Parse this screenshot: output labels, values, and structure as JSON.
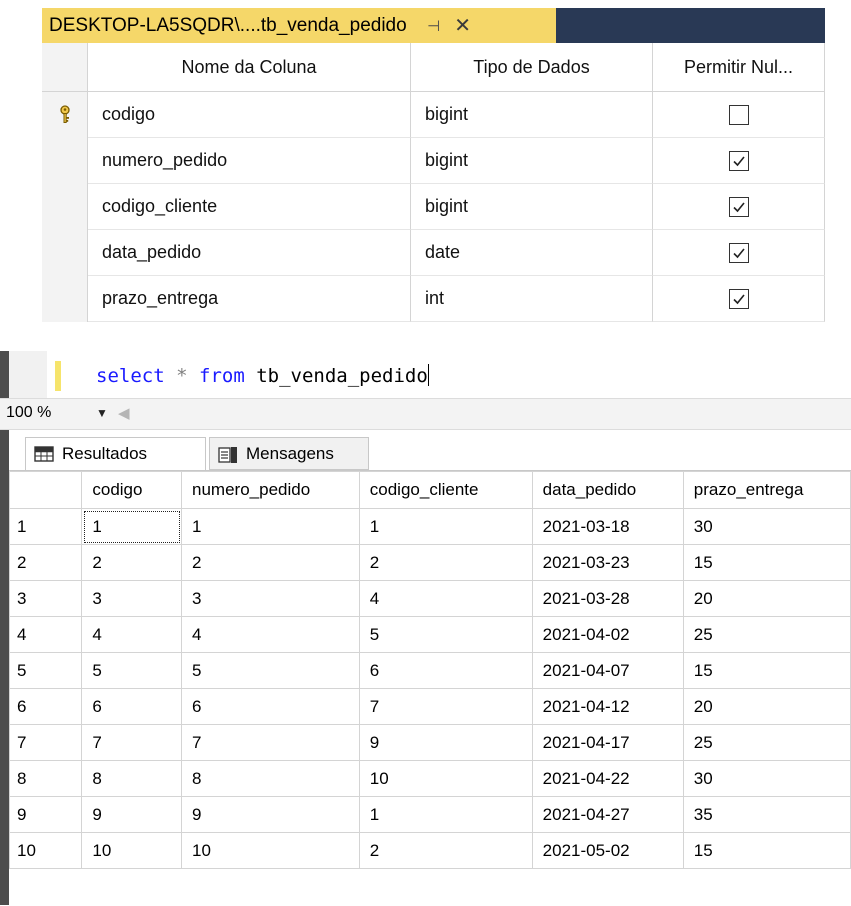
{
  "designer": {
    "tab_title": "DESKTOP-LA5SQDR\\....tb_venda_pedido",
    "columns_header": {
      "name": "Nome da Coluna",
      "type": "Tipo de Dados",
      "nullable": "Permitir Nul..."
    },
    "rows": [
      {
        "name": "codigo",
        "type": "bigint",
        "allow_null": false,
        "primary_key": true
      },
      {
        "name": "numero_pedido",
        "type": "bigint",
        "allow_null": true,
        "primary_key": false
      },
      {
        "name": "codigo_cliente",
        "type": "bigint",
        "allow_null": true,
        "primary_key": false
      },
      {
        "name": "data_pedido",
        "type": "date",
        "allow_null": true,
        "primary_key": false
      },
      {
        "name": "prazo_entrega",
        "type": "int",
        "allow_null": true,
        "primary_key": false
      }
    ]
  },
  "editor": {
    "query": {
      "kw1": "select",
      "star": "*",
      "kw2": "from",
      "table": "tb_venda_pedido"
    },
    "zoom": "100 %",
    "tabs": {
      "results": "Resultados",
      "messages": "Mensagens"
    }
  },
  "results": {
    "headers": [
      "codigo",
      "numero_pedido",
      "codigo_cliente",
      "data_pedido",
      "prazo_entrega"
    ],
    "rows": [
      [
        "1",
        "1",
        "1",
        "1",
        "2021-03-18",
        "30"
      ],
      [
        "2",
        "2",
        "2",
        "2",
        "2021-03-23",
        "15"
      ],
      [
        "3",
        "3",
        "3",
        "4",
        "2021-03-28",
        "20"
      ],
      [
        "4",
        "4",
        "4",
        "5",
        "2021-04-02",
        "25"
      ],
      [
        "5",
        "5",
        "5",
        "6",
        "2021-04-07",
        "15"
      ],
      [
        "6",
        "6",
        "6",
        "7",
        "2021-04-12",
        "20"
      ],
      [
        "7",
        "7",
        "7",
        "9",
        "2021-04-17",
        "25"
      ],
      [
        "8",
        "8",
        "8",
        "10",
        "2021-04-22",
        "30"
      ],
      [
        "9",
        "9",
        "9",
        "1",
        "2021-04-27",
        "35"
      ],
      [
        "10",
        "10",
        "10",
        "2",
        "2021-05-02",
        "15"
      ]
    ]
  }
}
